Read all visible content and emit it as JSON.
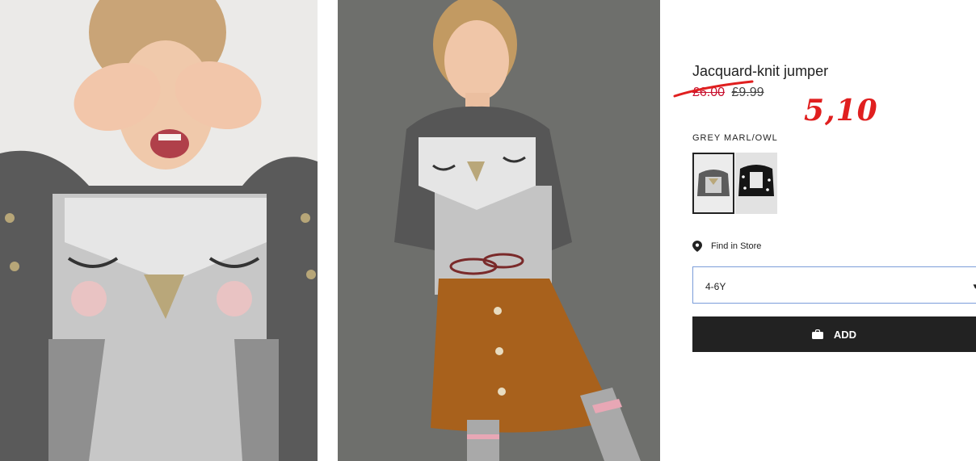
{
  "product": {
    "title": "Jacquard-knit jumper",
    "price_sale": "£6.00",
    "price_original": "£9.99",
    "handwritten_price": "5,10",
    "color_label": "GREY MARL/OWL",
    "find_in_store": "Find in Store",
    "size_selected": "4-6Y",
    "add_label": "ADD"
  },
  "colors": {
    "accent": "#e01f1f",
    "button_bg": "#222222",
    "select_border": "#7b9dd9"
  },
  "icons": {
    "pin": "location-pin-icon",
    "bag": "shopping-bag-icon",
    "chevron": "chevron-down-icon"
  }
}
